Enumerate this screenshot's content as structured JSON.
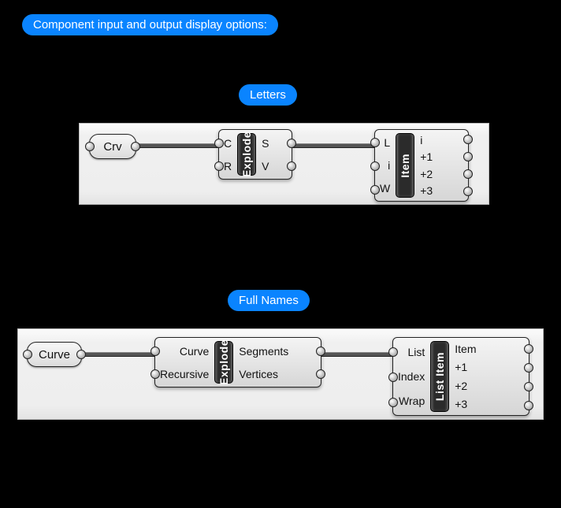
{
  "header": {
    "title": "Component input and output display options:"
  },
  "sections": [
    {
      "label": "Letters"
    },
    {
      "label": "Full Names"
    }
  ],
  "letters": {
    "crv_param": "Crv",
    "explode": {
      "name": "Explode",
      "inputs": [
        "C",
        "R"
      ],
      "outputs": [
        "S",
        "V"
      ]
    },
    "item": {
      "name": "Item",
      "inputs": [
        "L",
        "i",
        "W"
      ],
      "outputs": [
        "i",
        "+1",
        "+2",
        "+3"
      ]
    }
  },
  "fullnames": {
    "curve_param": "Curve",
    "explode": {
      "name": "Explode",
      "inputs": [
        "Curve",
        "Recursive"
      ],
      "outputs": [
        "Segments",
        "Vertices"
      ]
    },
    "listitem": {
      "name": "List Item",
      "inputs": [
        "List",
        "Index",
        "Wrap"
      ],
      "outputs": [
        "Item",
        "+1",
        "+2",
        "+3"
      ]
    }
  }
}
